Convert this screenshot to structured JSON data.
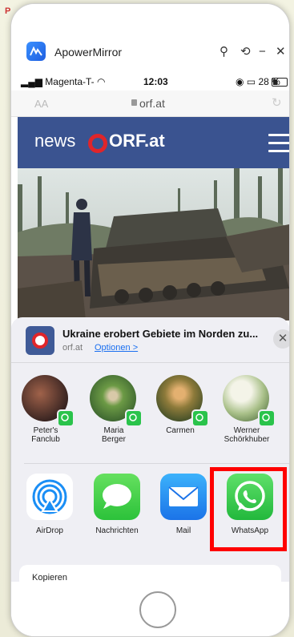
{
  "window": {
    "title": "ApowerMirror",
    "buttons": {
      "pin": "⚲",
      "rotate": "⟲",
      "minimize": "−",
      "close": "✕"
    }
  },
  "status_bar": {
    "carrier": "Magenta-T-",
    "time": "12:03",
    "battery_text": "28 %"
  },
  "browser": {
    "text_size": "AA",
    "url": "orf.at"
  },
  "site": {
    "logo_news": "news",
    "logo_orf": "ORF.at"
  },
  "share_sheet": {
    "article_title": "Ukraine erobert Gebiete im Norden zu...",
    "article_site": "orf.at",
    "options_link": "Optionen >",
    "close_icon": "✕",
    "contacts": [
      {
        "name_line1": "Peter's",
        "name_line2": "Fanclub"
      },
      {
        "name_line1": "Maria",
        "name_line2": "Berger"
      },
      {
        "name_line1": "Carmen",
        "name_line2": ""
      },
      {
        "name_line1": "Werner",
        "name_line2": "Schörkhuber"
      }
    ],
    "apps": [
      {
        "label": "AirDrop"
      },
      {
        "label": "Nachrichten"
      },
      {
        "label": "Mail"
      },
      {
        "label": "WhatsApp"
      }
    ],
    "next_row_label": "Kopieren"
  },
  "colors": {
    "orf_blue": "#3a5390",
    "orf_red": "#e0252a",
    "whatsapp_green": "#2ac34b",
    "highlight": "#ff0000"
  }
}
